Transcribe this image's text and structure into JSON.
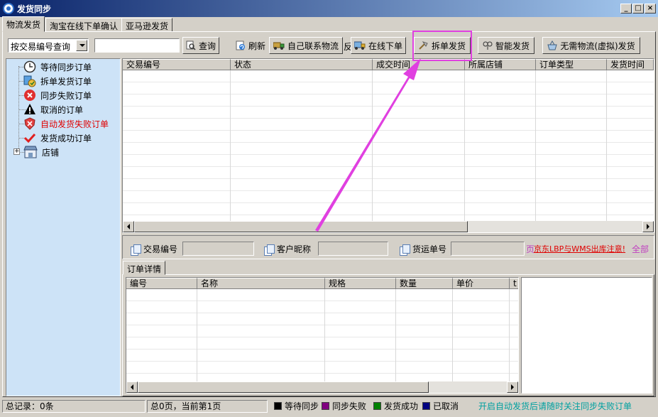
{
  "window": {
    "title": "发货同步",
    "icon": "app-globe-icon"
  },
  "tabs": [
    {
      "label": "物流发货",
      "active": true
    },
    {
      "label": "淘宝在线下单确认",
      "active": false
    },
    {
      "label": "亚马逊发货",
      "active": false
    }
  ],
  "toolbar": {
    "search_mode": "按交易编号查询",
    "search_value": "",
    "query_label": "查询",
    "refresh_label": "刷新",
    "self_contact_label": "自己联系物流",
    "self_contact_overflow": "反",
    "online_order_label": "在线下单",
    "split_ship_label": "拆单发货",
    "smart_ship_label": "智能发货",
    "virtual_ship_label": "无需物流(虚拟)发货"
  },
  "tree": {
    "items": [
      {
        "label": "等待同步订单",
        "icon": "clock-icon"
      },
      {
        "label": "拆单发货订单",
        "icon": "split-order-icon"
      },
      {
        "label": "同步失败订单",
        "icon": "error-icon"
      },
      {
        "label": "取消的订单",
        "icon": "warning-icon"
      },
      {
        "label": "自动发货失败订单",
        "icon": "shield-fail-icon",
        "highlight": "#e00000"
      },
      {
        "label": "发货成功订单",
        "icon": "checkmark-icon"
      },
      {
        "label": "店铺",
        "icon": "store-icon",
        "expander": "+"
      }
    ]
  },
  "orders_table": {
    "columns": [
      "交易编号",
      "状态",
      "成交时间",
      "所属店铺",
      "订单类型",
      "发货时间"
    ],
    "rows": []
  },
  "search_strip": {
    "trade_no_label": "交易编号",
    "trade_no_value": "",
    "nickname_label": "客户昵称",
    "nickname_value": "",
    "waybill_label": "货运单号",
    "waybill_value": "",
    "page_prefix": "页",
    "warning_link": "京东LBP与WMS出库注意!",
    "all_link": "全部"
  },
  "detail_tabs": [
    {
      "label": "订单详情",
      "active": true
    }
  ],
  "detail_table": {
    "columns": [
      "编号",
      "名称",
      "规格",
      "数量",
      "单价",
      "t"
    ],
    "rows": []
  },
  "status_bar": {
    "total_records": "总记录：0条",
    "pages": "总0页，当前第1页",
    "legend": [
      {
        "label": "等待同步",
        "color": "#000000"
      },
      {
        "label": "同步失败",
        "color": "#800080"
      },
      {
        "label": "发货成功",
        "color": "#008000"
      },
      {
        "label": "已取消",
        "color": "#000080"
      }
    ],
    "hint": "开启自动发货后请随时关注同步失败订单",
    "hint_color": "#00a0a0"
  },
  "annotation": {
    "color": "#e040e0"
  }
}
